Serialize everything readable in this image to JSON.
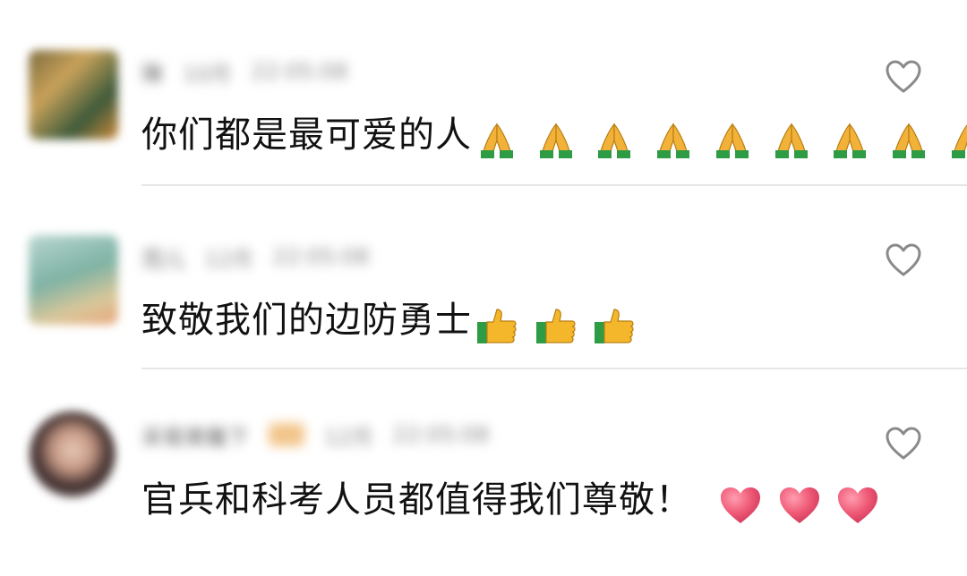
{
  "comments": [
    {
      "username": "陳",
      "meta": [
        "10月",
        "22:05:08"
      ],
      "text": "你们都是最可爱的人",
      "emoji": "folded-hands",
      "emoji_count": 9
    },
    {
      "username": "范儿",
      "meta": [
        "12月",
        "22:05:08"
      ],
      "text": "致敬我们的边防勇士",
      "emoji": "thumbs-up",
      "emoji_count": 3
    },
    {
      "username": "采菊東籬下",
      "meta": [
        "12月",
        "22:05:08"
      ],
      "text": "官兵和科考人员都值得我们尊敬！",
      "emoji": "heart",
      "emoji_count": 3
    }
  ],
  "icons": {
    "like": "heart-outline-icon",
    "folded_hands": "folded-hands-icon",
    "thumbs_up": "thumbs-up-icon",
    "heart": "heart-emoji-icon"
  },
  "colors": {
    "like_outline": "#8a8a8a",
    "divider": "#e6e6e6",
    "text": "#111111",
    "meta": "#8c8c8c",
    "heart_emoji": "#ef5a77",
    "thumb": "#f4b72c",
    "hands": "#f2b23a",
    "sleeve": "#2e9b45"
  }
}
